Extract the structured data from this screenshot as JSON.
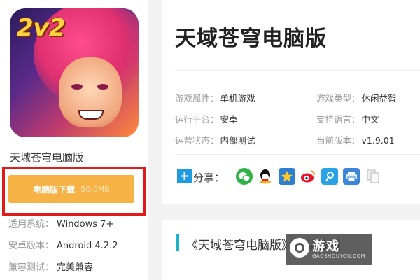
{
  "app": {
    "title": "天域苍穹电脑版",
    "icon_badge": "2v2"
  },
  "download": {
    "label": "电脑版下载",
    "size": "50.0MB"
  },
  "specs": [
    {
      "label": "适用系统：",
      "value": "Windows 7+"
    },
    {
      "label": "安卓版本：",
      "value": "Android 4.2.2"
    },
    {
      "label": "兼容测试：",
      "value": "完美兼容"
    }
  ],
  "main": {
    "title": "天域苍穹电脑版",
    "attributes": [
      {
        "label": "游戏属性：",
        "value": "单机游戏"
      },
      {
        "label": "游戏类型：",
        "value": "休闲益智"
      },
      {
        "label": "运行平台：",
        "value": "安卓"
      },
      {
        "label": "支持语言：",
        "value": "中文"
      },
      {
        "label": "运营状态：",
        "value": "内部测试"
      },
      {
        "label": "当前版本：",
        "value": "v1.9.01"
      }
    ],
    "share_label": "分享：",
    "share_icons": [
      "wechat-icon",
      "qq-icon",
      "qzone-icon",
      "weibo-icon",
      "tencent-weibo-icon",
      "print-icon",
      "copy-icon"
    ]
  },
  "tutorial": {
    "title": "《天域苍穹电脑版》安装教程"
  },
  "watermark": {
    "text": "游戏",
    "url": "GAOSHOUYOU.COM"
  },
  "colors": {
    "download_button": "#f7b245",
    "highlight_outline": "#e21a1a",
    "share_plus": "#1d9ae0",
    "tutorial_bar": "#1bb3c9"
  }
}
